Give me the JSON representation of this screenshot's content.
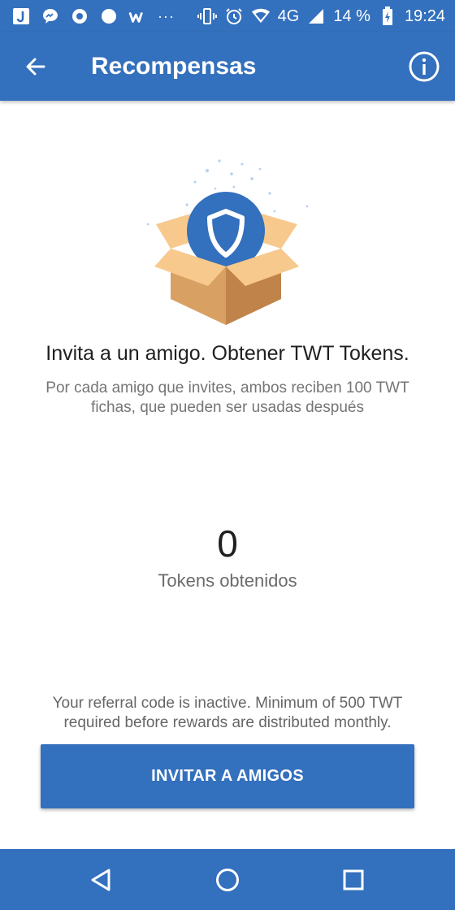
{
  "status_bar": {
    "battery": "14 %",
    "time": "19:24",
    "network": "4G",
    "overflow": "···",
    "icons": [
      "j-app-icon",
      "messenger-icon",
      "circle-app-icon",
      "circle-filled-icon",
      "w-app-icon",
      "vibrate-icon",
      "alarm-icon",
      "wifi-icon",
      "signal-icon",
      "battery-charging-icon"
    ]
  },
  "app_bar": {
    "title": "Recompensas",
    "back_icon": "arrow-back-icon",
    "info_icon": "info-icon"
  },
  "main": {
    "illustration": "gift-box-shield-icon",
    "headline": "Invita a un amigo. Obtener TWT Tokens.",
    "subtext": "Por cada amigo que invites, ambos reciben 100 TWT fichas, que pueden ser usadas después",
    "token_count": "0",
    "token_label": "Tokens obtenidos",
    "referral_note": "Your referral code is inactive. Minimum of 500 TWT required before rewards are distributed monthly.",
    "invite_button": "INVITAR A AMIGOS"
  },
  "nav_bar": {
    "icons": [
      "nav-back-icon",
      "nav-home-icon",
      "nav-recents-icon"
    ]
  },
  "colors": {
    "primary": "#3370bd",
    "box_light": "#f7c98d",
    "box_dark": "#c98b4e",
    "shield_blue": "#3370bd"
  }
}
